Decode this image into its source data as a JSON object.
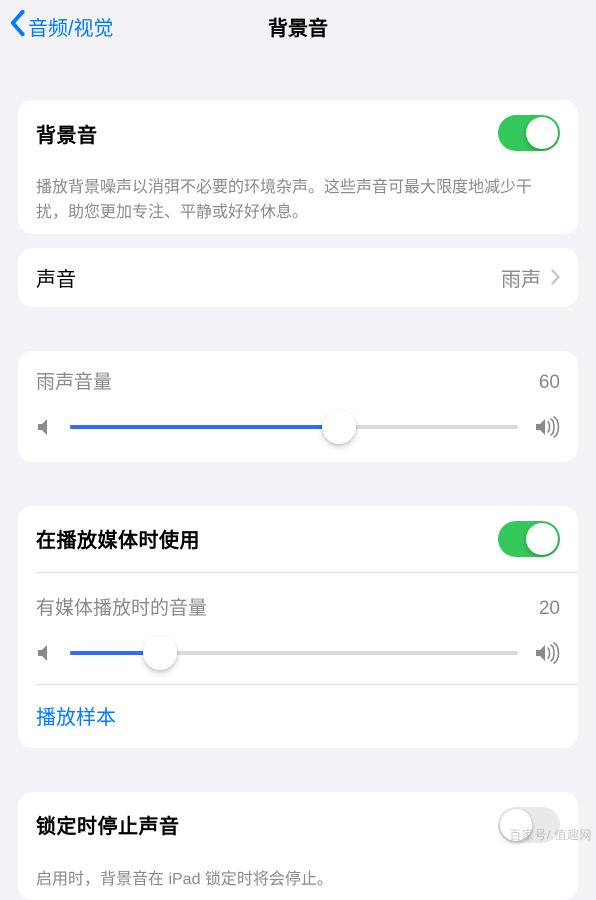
{
  "nav": {
    "back_label": "音频/视觉",
    "title": "背景音"
  },
  "main_toggle": {
    "label": "背景音",
    "on": true,
    "footer": "播放背景噪声以消弭不必要的环境杂声。这些声音可最大限度地减少干扰，助您更加专注、平静或好好休息。"
  },
  "sound": {
    "label": "声音",
    "value": "雨声"
  },
  "rain_volume": {
    "label": "雨声音量",
    "value": 60
  },
  "media": {
    "use_label": "在播放媒体时使用",
    "use_on": true,
    "volume_label": "有媒体播放时的音量",
    "volume_value": 20,
    "sample_label": "播放样本"
  },
  "lock_stop": {
    "label": "锁定时停止声音",
    "on": false,
    "footer": "启用时，背景音在 iPad 锁定时将会停止。"
  },
  "watermark": "百家号/ 值趣网"
}
